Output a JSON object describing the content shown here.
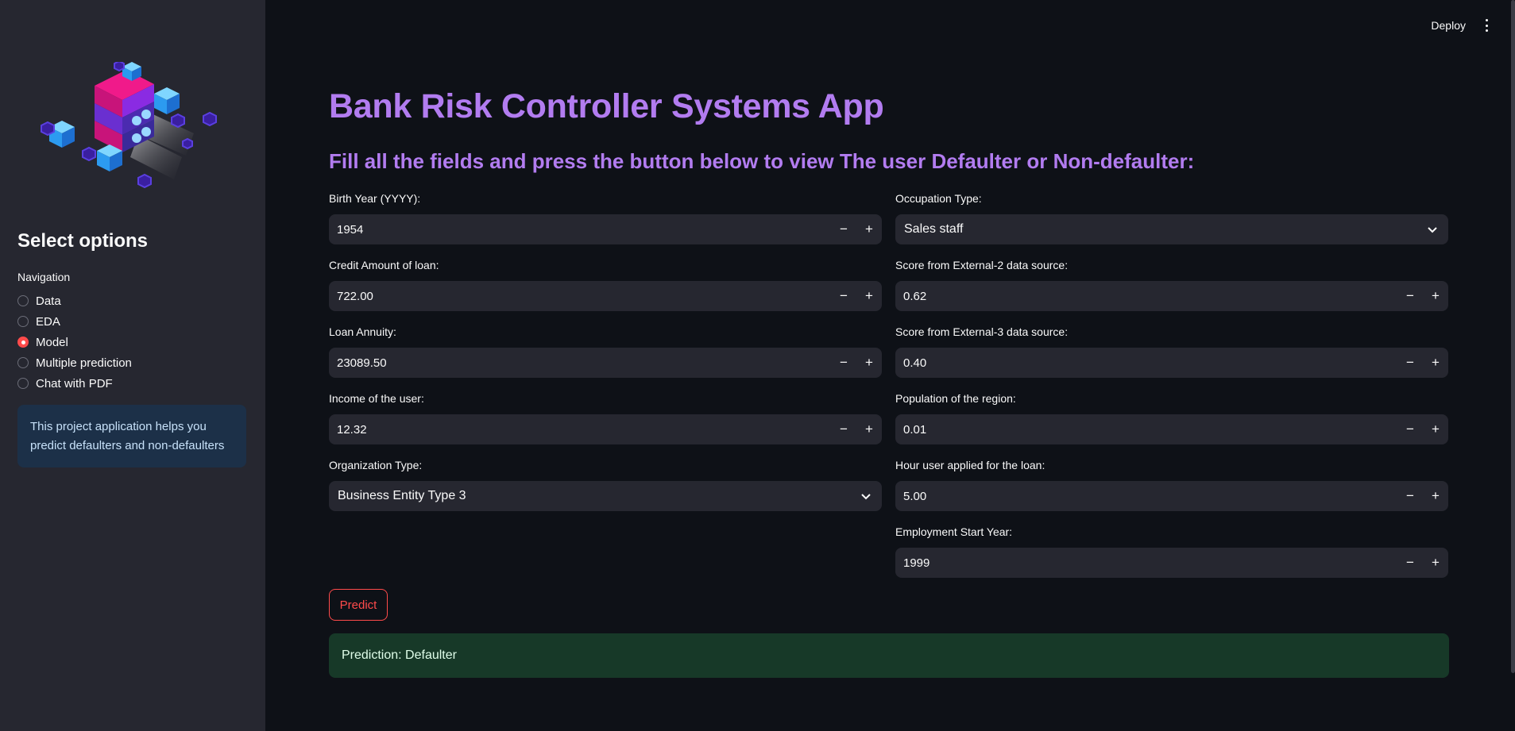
{
  "header": {
    "deploy_label": "Deploy"
  },
  "sidebar": {
    "title": "Select options",
    "nav_label": "Navigation",
    "options": [
      {
        "label": "Data",
        "selected": false
      },
      {
        "label": "EDA",
        "selected": false
      },
      {
        "label": "Model",
        "selected": true
      },
      {
        "label": "Multiple prediction",
        "selected": false
      },
      {
        "label": "Chat with PDF",
        "selected": false
      }
    ],
    "info_text": "This project application helps you predict defaulters and non-defaulters"
  },
  "main": {
    "title": "Bank Risk Controller Systems App",
    "subtitle": "Fill all the fields and press the button below to view The user Defaulter or Non-defaulter:",
    "left_fields": [
      {
        "label": "Birth Year (YYYY):",
        "value": "1954",
        "type": "number"
      },
      {
        "label": "Credit Amount of loan:",
        "value": "722.00",
        "type": "number"
      },
      {
        "label": "Loan Annuity:",
        "value": "23089.50",
        "type": "number"
      },
      {
        "label": "Income of the user:",
        "value": "12.32",
        "type": "number"
      },
      {
        "label": "Organization Type:",
        "value": "Business Entity Type 3",
        "type": "select"
      }
    ],
    "right_fields": [
      {
        "label": "Occupation Type:",
        "value": "Sales staff",
        "type": "select"
      },
      {
        "label": "Score from External-2 data source:",
        "value": "0.62",
        "type": "number"
      },
      {
        "label": "Score from External-3 data source:",
        "value": "0.40",
        "type": "number"
      },
      {
        "label": "Population of the region:",
        "value": "0.01",
        "type": "number"
      },
      {
        "label": "Hour user applied for the loan:",
        "value": "5.00",
        "type": "number"
      },
      {
        "label": "Employment Start Year:",
        "value": "1999",
        "type": "number"
      }
    ],
    "stepper_minus": "−",
    "stepper_plus": "+",
    "predict_label": "Predict",
    "result_text": "Prediction: Defaulter"
  },
  "colors": {
    "accent": "#ff4b4b",
    "title": "#b27cf0",
    "sidebar_bg": "#262730",
    "main_bg": "#0e1117",
    "info_bg": "#1c3048",
    "success_bg": "#173928"
  }
}
